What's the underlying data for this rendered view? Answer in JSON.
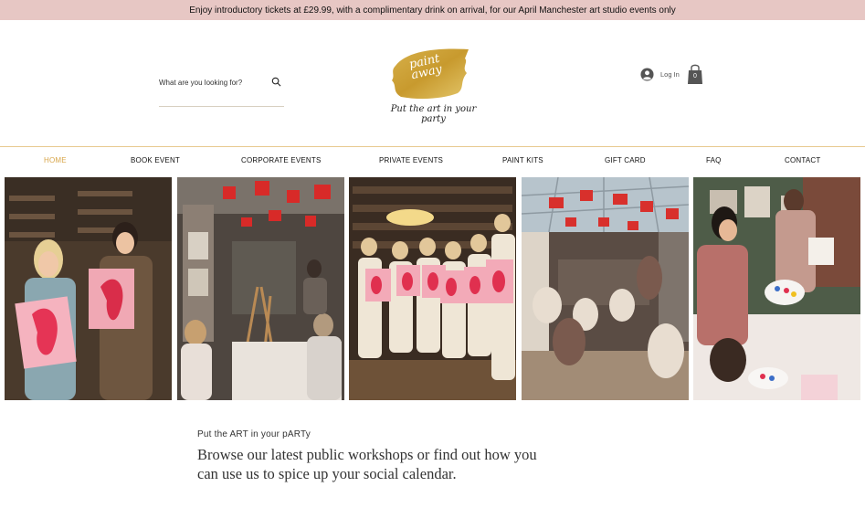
{
  "promo": {
    "text": "Enjoy introductory tickets at £29.99, with a complimentary drink on arrival, for our April Manchester art studio events only"
  },
  "header": {
    "search": {
      "placeholder": "What are you looking for?",
      "icon": "search-icon"
    },
    "logo": {
      "word_line1": "paint",
      "word_line2": "away",
      "tagline": "Put the art in your party"
    },
    "login": {
      "label": "Log In",
      "icon": "user-avatar-icon"
    },
    "cart": {
      "count": "0",
      "icon": "shopping-bag-icon"
    }
  },
  "nav": {
    "items": [
      {
        "label": "HOME",
        "active": true
      },
      {
        "label": "BOOK EVENT",
        "active": false
      },
      {
        "label": "CORPORATE EVENTS",
        "active": false
      },
      {
        "label": "PRIVATE EVENTS",
        "active": false
      },
      {
        "label": "PAINT KITS",
        "active": false
      },
      {
        "label": "GIFT CARD",
        "active": false
      },
      {
        "label": "FAQ",
        "active": false
      },
      {
        "label": "CONTACT",
        "active": false
      }
    ]
  },
  "gallery": {
    "photos": [
      "two-women-holding-flamingo-paintings",
      "painting-class-under-red-lanterns",
      "group-holding-flamingo-canvases",
      "busy-studio-with-glass-roof",
      "women-painting-at-table"
    ]
  },
  "intro": {
    "eyebrow": "Put the ART in your pARTy",
    "text": "Browse our latest public workshops or find out how you can use us to spice up your social calendar."
  },
  "colors": {
    "promo_bg": "#e7c7c4",
    "accent_gold": "#d8a64a",
    "nav_rule": "#e8c98f"
  }
}
